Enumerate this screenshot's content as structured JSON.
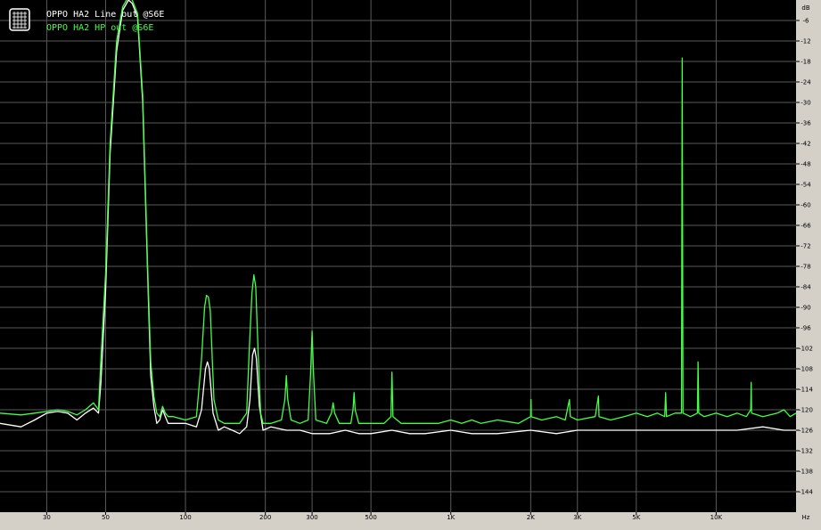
{
  "chart_data": {
    "type": "line",
    "title": "",
    "xlabel": "",
    "ylabel": "",
    "x_unit": "Hz",
    "y_unit": "dB",
    "x_scale": "log",
    "xlim": [
      20,
      20000
    ],
    "ylim": [
      -150,
      0
    ],
    "grid": true,
    "legend_position": "top-left",
    "background_color": "#000000",
    "grid_color": "#5a5a5a",
    "x_ticks": [
      {
        "value": 30,
        "label": "30"
      },
      {
        "value": 50,
        "label": "50"
      },
      {
        "value": 100,
        "label": "100"
      },
      {
        "value": 200,
        "label": "200"
      },
      {
        "value": 300,
        "label": "300"
      },
      {
        "value": 500,
        "label": "500"
      },
      {
        "value": 1000,
        "label": "1K"
      },
      {
        "value": 2000,
        "label": "2K"
      },
      {
        "value": 3000,
        "label": "3K"
      },
      {
        "value": 5000,
        "label": "5K"
      },
      {
        "value": 10000,
        "label": "10K"
      }
    ],
    "y_ticks": [
      {
        "value": -6,
        "label": "-6"
      },
      {
        "value": -12,
        "label": "-12"
      },
      {
        "value": -18,
        "label": "-18"
      },
      {
        "value": -24,
        "label": "-24"
      },
      {
        "value": -30,
        "label": "-30"
      },
      {
        "value": -36,
        "label": "-36"
      },
      {
        "value": -42,
        "label": "-42"
      },
      {
        "value": -48,
        "label": "-48"
      },
      {
        "value": -54,
        "label": "-54"
      },
      {
        "value": -60,
        "label": "-60"
      },
      {
        "value": -66,
        "label": "-66"
      },
      {
        "value": -72,
        "label": "-72"
      },
      {
        "value": -78,
        "label": "-78"
      },
      {
        "value": -84,
        "label": "-84"
      },
      {
        "value": -90,
        "label": "-90"
      },
      {
        "value": -96,
        "label": "-96"
      },
      {
        "value": -102,
        "label": "-102"
      },
      {
        "value": -108,
        "label": "-108"
      },
      {
        "value": -114,
        "label": "-114"
      },
      {
        "value": -120,
        "label": "-120"
      },
      {
        "value": -126,
        "label": "-126"
      },
      {
        "value": -132,
        "label": "-132"
      },
      {
        "value": -138,
        "label": "-138"
      },
      {
        "value": -144,
        "label": "-144"
      }
    ],
    "series": [
      {
        "name": "OPPO HA2 Line out @S6E",
        "color": "#ffffff",
        "points": [
          [
            20,
            -124
          ],
          [
            24,
            -125
          ],
          [
            27,
            -123
          ],
          [
            30,
            -121
          ],
          [
            33,
            -120.5
          ],
          [
            36,
            -121
          ],
          [
            39,
            -123
          ],
          [
            42,
            -121
          ],
          [
            45,
            -119.5
          ],
          [
            47,
            -121
          ],
          [
            48,
            -112
          ],
          [
            50,
            -85
          ],
          [
            52,
            -45
          ],
          [
            55,
            -15
          ],
          [
            58,
            -3
          ],
          [
            61,
            0
          ],
          [
            63,
            -1
          ],
          [
            66,
            -5
          ],
          [
            69,
            -30
          ],
          [
            72,
            -80
          ],
          [
            74,
            -110
          ],
          [
            76,
            -119
          ],
          [
            78,
            -124
          ],
          [
            80,
            -123
          ],
          [
            82,
            -120
          ],
          [
            84,
            -122
          ],
          [
            86,
            -124
          ],
          [
            90,
            -124
          ],
          [
            100,
            -124
          ],
          [
            110,
            -125
          ],
          [
            115,
            -120
          ],
          [
            119,
            -108
          ],
          [
            121,
            -106
          ],
          [
            123,
            -108
          ],
          [
            127,
            -121
          ],
          [
            133,
            -126
          ],
          [
            140,
            -125
          ],
          [
            150,
            -126
          ],
          [
            160,
            -127
          ],
          [
            170,
            -125
          ],
          [
            175,
            -117
          ],
          [
            179,
            -104
          ],
          [
            182,
            -102
          ],
          [
            185,
            -105
          ],
          [
            190,
            -119
          ],
          [
            196,
            -126
          ],
          [
            210,
            -125
          ],
          [
            240,
            -126
          ],
          [
            270,
            -126
          ],
          [
            300,
            -127
          ],
          [
            350,
            -127
          ],
          [
            400,
            -126
          ],
          [
            450,
            -127
          ],
          [
            500,
            -127
          ],
          [
            600,
            -126
          ],
          [
            700,
            -127
          ],
          [
            800,
            -127
          ],
          [
            1000,
            -126
          ],
          [
            1200,
            -127
          ],
          [
            1500,
            -127
          ],
          [
            2000,
            -126
          ],
          [
            2500,
            -127
          ],
          [
            3000,
            -126
          ],
          [
            4000,
            -126
          ],
          [
            5000,
            -126
          ],
          [
            6000,
            -126
          ],
          [
            7000,
            -126
          ],
          [
            8000,
            -126
          ],
          [
            10000,
            -126
          ],
          [
            12000,
            -126
          ],
          [
            15000,
            -125
          ],
          [
            18000,
            -126
          ],
          [
            20000,
            -126
          ]
        ]
      },
      {
        "name": "OPPO HA2 HP out @S6E",
        "color": "#44ff44",
        "points": [
          [
            20,
            -121
          ],
          [
            24,
            -121.5
          ],
          [
            27,
            -121
          ],
          [
            30,
            -120.5
          ],
          [
            33,
            -120
          ],
          [
            36,
            -120.5
          ],
          [
            39,
            -121.5
          ],
          [
            42,
            -120
          ],
          [
            45,
            -118
          ],
          [
            47,
            -120
          ],
          [
            48,
            -105
          ],
          [
            50,
            -80
          ],
          [
            52,
            -42
          ],
          [
            55,
            -12
          ],
          [
            58,
            -2
          ],
          [
            61,
            1
          ],
          [
            63,
            0
          ],
          [
            66,
            -4
          ],
          [
            69,
            -28
          ],
          [
            72,
            -78
          ],
          [
            74,
            -106
          ],
          [
            76,
            -116
          ],
          [
            78,
            -121
          ],
          [
            80,
            -122
          ],
          [
            82,
            -119
          ],
          [
            84,
            -121
          ],
          [
            86,
            -122
          ],
          [
            90,
            -122
          ],
          [
            100,
            -123
          ],
          [
            110,
            -122
          ],
          [
            115,
            -105
          ],
          [
            118,
            -90
          ],
          [
            120,
            -86.5
          ],
          [
            122,
            -87
          ],
          [
            124,
            -91
          ],
          [
            128,
            -117
          ],
          [
            133,
            -123
          ],
          [
            140,
            -124
          ],
          [
            150,
            -124
          ],
          [
            160,
            -124
          ],
          [
            170,
            -121
          ],
          [
            174,
            -102
          ],
          [
            178,
            -86
          ],
          [
            181,
            -80.5
          ],
          [
            184,
            -84
          ],
          [
            188,
            -104
          ],
          [
            192,
            -121
          ],
          [
            196,
            -124
          ],
          [
            210,
            -124
          ],
          [
            230,
            -123
          ],
          [
            237,
            -117
          ],
          [
            240,
            -110
          ],
          [
            243,
            -117
          ],
          [
            250,
            -123
          ],
          [
            270,
            -124
          ],
          [
            290,
            -123
          ],
          [
            296,
            -110
          ],
          [
            300,
            -97
          ],
          [
            304,
            -110
          ],
          [
            310,
            -123
          ],
          [
            340,
            -124
          ],
          [
            355,
            -121
          ],
          [
            360,
            -118
          ],
          [
            365,
            -121
          ],
          [
            380,
            -124
          ],
          [
            420,
            -124
          ],
          [
            428,
            -120
          ],
          [
            432,
            -115
          ],
          [
            436,
            -120
          ],
          [
            450,
            -124
          ],
          [
            500,
            -124
          ],
          [
            560,
            -124
          ],
          [
            595,
            -122
          ],
          [
            600,
            -109
          ],
          [
            605,
            -122
          ],
          [
            650,
            -124
          ],
          [
            700,
            -124
          ],
          [
            800,
            -124
          ],
          [
            900,
            -124
          ],
          [
            1000,
            -123
          ],
          [
            1100,
            -124
          ],
          [
            1200,
            -123
          ],
          [
            1300,
            -124
          ],
          [
            1500,
            -123
          ],
          [
            1800,
            -124
          ],
          [
            2000,
            -122
          ],
          [
            2005,
            -117
          ],
          [
            2010,
            -122
          ],
          [
            2200,
            -123
          ],
          [
            2500,
            -122
          ],
          [
            2700,
            -123
          ],
          [
            2800,
            -117
          ],
          [
            2820,
            -122
          ],
          [
            3000,
            -123
          ],
          [
            3500,
            -122
          ],
          [
            3600,
            -116
          ],
          [
            3620,
            -122
          ],
          [
            4000,
            -123
          ],
          [
            4500,
            -122
          ],
          [
            5000,
            -121
          ],
          [
            5500,
            -122
          ],
          [
            6000,
            -121
          ],
          [
            6400,
            -122
          ],
          [
            6450,
            -115
          ],
          [
            6500,
            -122
          ],
          [
            7000,
            -121
          ],
          [
            7400,
            -121
          ],
          [
            7450,
            -17
          ],
          [
            7500,
            -121
          ],
          [
            8000,
            -122
          ],
          [
            8500,
            -121
          ],
          [
            8550,
            -106
          ],
          [
            8600,
            -121
          ],
          [
            9000,
            -122
          ],
          [
            10000,
            -121
          ],
          [
            11000,
            -122
          ],
          [
            12000,
            -121
          ],
          [
            13000,
            -122
          ],
          [
            13500,
            -120
          ],
          [
            13550,
            -112
          ],
          [
            13600,
            -121
          ],
          [
            15000,
            -122
          ],
          [
            17000,
            -121
          ],
          [
            18000,
            -120
          ],
          [
            19000,
            -122
          ],
          [
            20000,
            -121
          ]
        ]
      }
    ]
  }
}
